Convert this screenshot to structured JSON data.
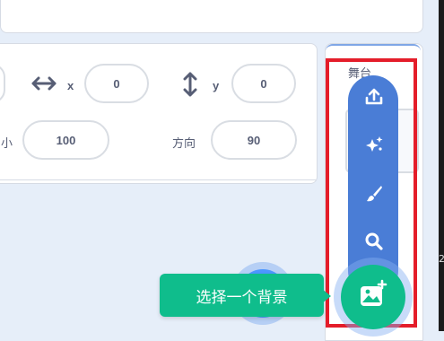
{
  "sprite_info": {
    "x_label": "x",
    "x_value": "0",
    "y_label": "y",
    "y_value": "0",
    "size_label": "小",
    "size_value": "100",
    "direction_label": "方向",
    "direction_value": "90"
  },
  "stage": {
    "label": "舞台"
  },
  "backdrop_menu": {
    "items": [
      {
        "icon": "upload-icon"
      },
      {
        "icon": "surprise-icon"
      },
      {
        "icon": "paint-icon"
      },
      {
        "icon": "search-icon"
      }
    ],
    "main_button_icon": "choose-backdrop-icon",
    "tooltip": "选择一个背景"
  },
  "colors": {
    "menu_blue": "#4a7dd6",
    "fab_green": "#0fbd8c",
    "highlight_red": "#e41d2a"
  }
}
